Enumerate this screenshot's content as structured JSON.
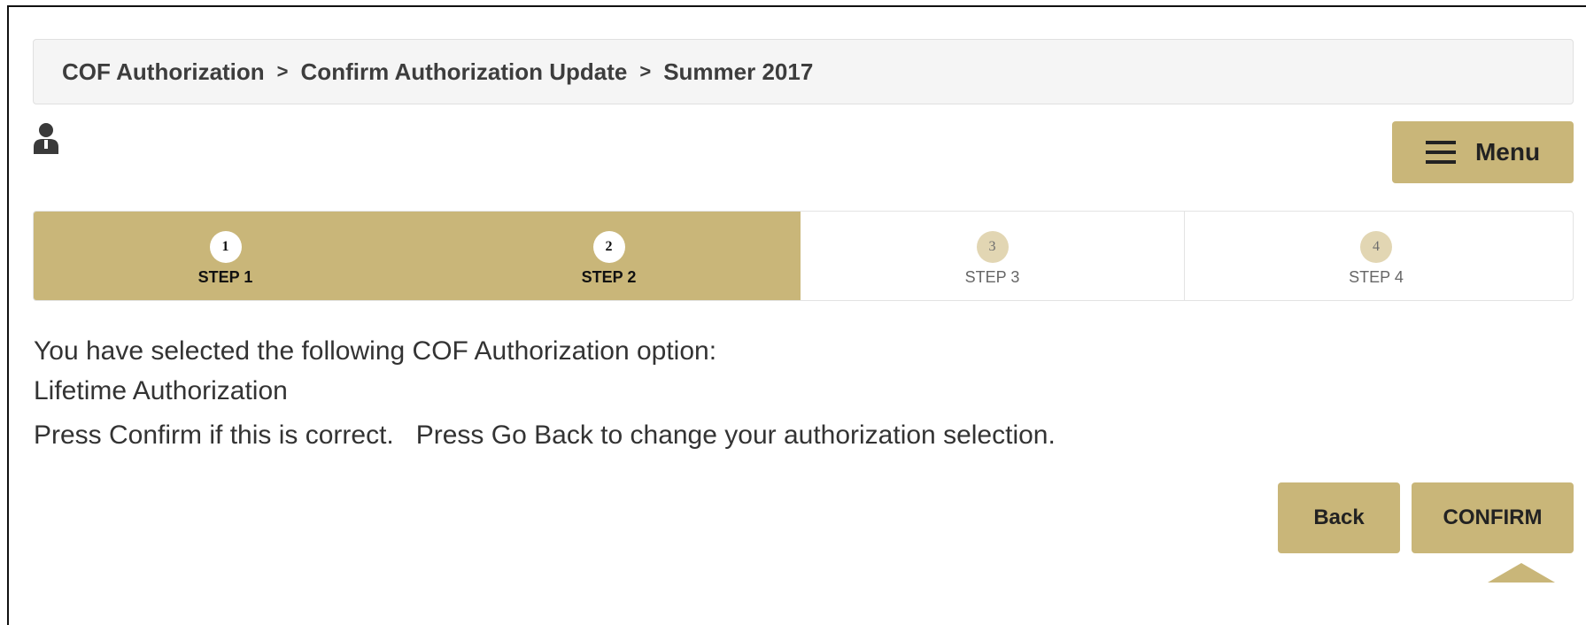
{
  "breadcrumb": {
    "items": [
      "COF Authorization",
      "Confirm Authorization Update",
      "Summer 2017"
    ],
    "separator": ">"
  },
  "header": {
    "user_icon": "user-icon",
    "menu_label": "Menu",
    "menu_icon": "hamburger-icon"
  },
  "steps": {
    "items": [
      {
        "number": "1",
        "label": "STEP 1",
        "state": "complete"
      },
      {
        "number": "2",
        "label": "STEP 2",
        "state": "complete"
      },
      {
        "number": "3",
        "label": "STEP 3",
        "state": "pending"
      },
      {
        "number": "4",
        "label": "STEP 4",
        "state": "pending"
      }
    ]
  },
  "message": {
    "line1": "You have selected the following COF Authorization option:",
    "line2": "Lifetime Authorization",
    "line3": "Press Confirm if this is correct.   Press Go Back to change your authorization selection."
  },
  "actions": {
    "back_label": "Back",
    "confirm_label": "CONFIRM"
  },
  "colors": {
    "accent": "#c9b679",
    "breadcrumb_bg": "#f5f5f5",
    "text": "#333333"
  }
}
